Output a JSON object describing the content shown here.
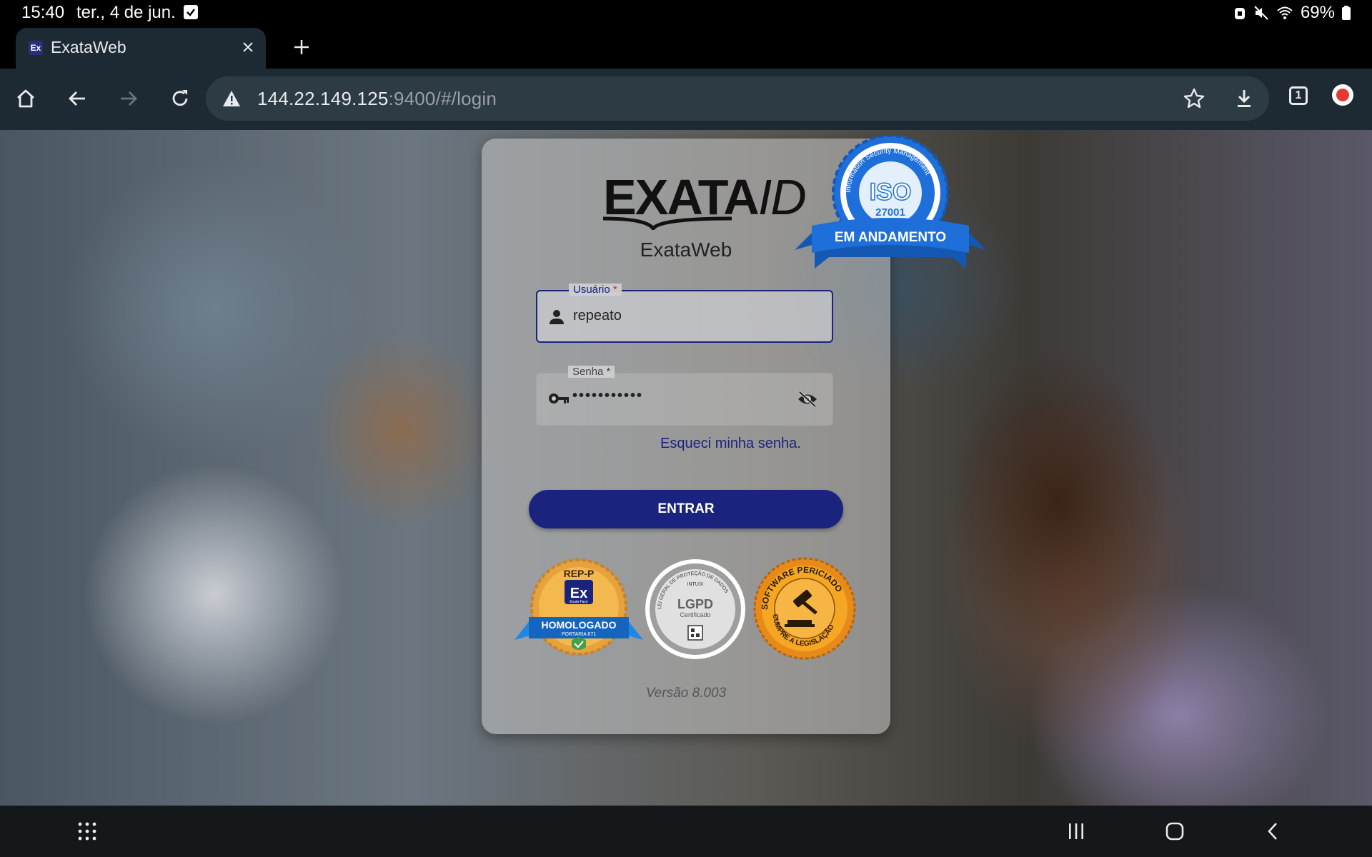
{
  "status_bar": {
    "time": "15:40",
    "date": "ter., 4 de jun.",
    "battery": "69%"
  },
  "browser": {
    "tab_title": "ExataWeb",
    "tab_favicon_text": "Ex",
    "url_host": "144.22.149.125",
    "url_path": ":9400/#/login",
    "tabs_count": "1"
  },
  "login": {
    "logo_main": "EXATA",
    "logo_id": "ID",
    "app_name": "ExataWeb",
    "user_label": "Usuário",
    "user_value": "repeato",
    "pass_label": "Senha",
    "pass_value": "•••••••••••",
    "required_marker": "*",
    "forgot_link": "Esqueci minha senha.",
    "enter_button": "ENTRAR",
    "version": "Versão 8.003"
  },
  "badges": {
    "rep_top": "REP-P",
    "rep_logo": "Ex",
    "rep_logo_sub": "Exata Face",
    "rep_ribbon": "HOMOLOGADO",
    "rep_sub": "PORTARIA 671",
    "lgpd_arc": "LEI GERAL DE PROTEÇÃO DE DADOS",
    "lgpd_brand": "INTUIX",
    "lgpd_main": "LGPD",
    "lgpd_sub": "Certificado",
    "perito_top": "SOFTWARE PERICIADO",
    "perito_bottom": "CUMPRE A LEGISLAÇÃO",
    "iso_arc": "Information Security Management",
    "iso_main": "ISO",
    "iso_num": "27001",
    "iso_ribbon": "EM ANDAMENTO"
  },
  "colors": {
    "primary": "#1a237e",
    "toolbar": "#1e2a33",
    "omnibox": "#2d3b45"
  }
}
